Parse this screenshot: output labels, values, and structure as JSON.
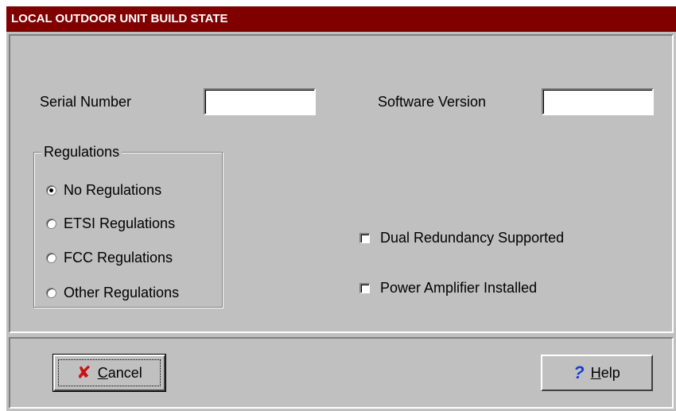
{
  "window": {
    "title": "LOCAL OUTDOOR UNIT BUILD STATE"
  },
  "fields": {
    "serial_label": "Serial Number",
    "serial_value": "",
    "software_label": "Software Version",
    "software_value": ""
  },
  "regulations": {
    "legend": "Regulations",
    "options": [
      {
        "label": "No Regulations",
        "checked": true
      },
      {
        "label": "ETSI Regulations",
        "checked": false
      },
      {
        "label": "FCC Regulations",
        "checked": false
      },
      {
        "label": "Other Regulations",
        "checked": false
      }
    ]
  },
  "checkboxes": [
    {
      "label": "Dual Redundancy Supported",
      "checked": false
    },
    {
      "label": "Power Amplifier Installed",
      "checked": false
    }
  ],
  "buttons": {
    "cancel": {
      "mnemonic": "C",
      "rest": "ancel",
      "icon": "close-x-icon"
    },
    "help": {
      "mnemonic": "H",
      "rest": "elp",
      "icon": "question-mark-icon"
    }
  },
  "colors": {
    "titlebar": "#800000",
    "face": "#c0c0c0",
    "cancel_icon": "#d01010",
    "help_icon": "#1a3fd0"
  }
}
